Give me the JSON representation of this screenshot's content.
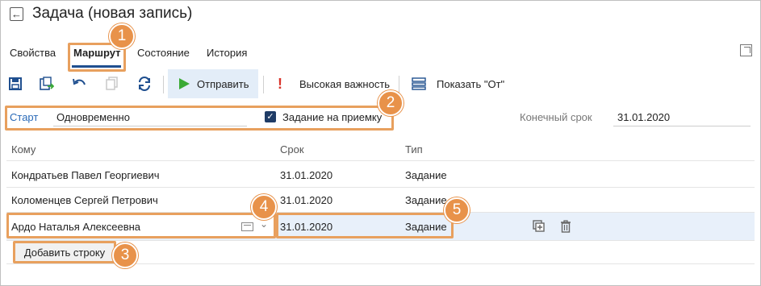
{
  "header": {
    "title": "Задача (новая запись)"
  },
  "tabs": [
    {
      "label": "Свойства",
      "active": false
    },
    {
      "label": "Маршрут",
      "active": true
    },
    {
      "label": "Состояние",
      "active": false
    },
    {
      "label": "История",
      "active": false
    }
  ],
  "toolbar": {
    "send_label": "Отправить",
    "importance_label": "Высокая важность",
    "show_from_label": "Показать \"От\""
  },
  "route": {
    "start_label": "Старт",
    "start_value": "Одновременно",
    "acceptance_checkbox_label": "Задание на приемку",
    "acceptance_checked": true,
    "deadline_label": "Конечный срок",
    "deadline_value": "31.01.2020"
  },
  "table": {
    "headers": [
      "Кому",
      "Срок",
      "Тип"
    ],
    "rows": [
      {
        "to": "Кондратьев Павел Георгиевич",
        "due": "31.01.2020",
        "type": "Задание"
      },
      {
        "to": "Коломенцев Сергей Петрович",
        "due": "31.01.2020",
        "type": "Задание"
      },
      {
        "to": "Ардо Наталья Алексеевна",
        "due": "31.01.2020",
        "type": "Задание"
      }
    ],
    "add_row_label": "Добавить строку"
  },
  "callouts": [
    "1",
    "2",
    "3",
    "4",
    "5"
  ],
  "colors": {
    "accent": "#1f4f8f",
    "link_blue": "#2a6ab8",
    "callout_orange": "#e8924a",
    "send_green": "#3aaa35",
    "importance_red": "#d9342b",
    "selected_row": "#e8f0fa"
  }
}
